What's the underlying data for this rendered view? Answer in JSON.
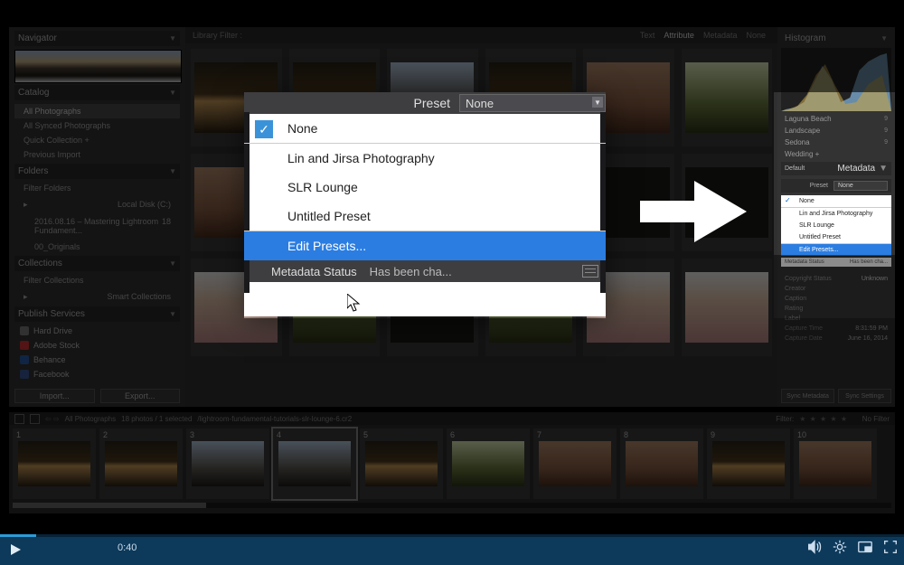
{
  "leftPanels": {
    "navigator": "Navigator",
    "catalog": {
      "title": "Catalog",
      "items": [
        "All Photographs",
        "All Synced Photographs",
        "Quick Collection +",
        "Previous Import"
      ]
    },
    "folders": {
      "title": "Folders",
      "filter": "Filter Folders",
      "drive": "Local Disk (C:)",
      "sub1": "2016.08.16 – Mastering Lightroom Fundament...",
      "sub2": "00_Originals",
      "count": "18"
    },
    "collections": {
      "title": "Collections",
      "filter": "Filter Collections",
      "smart": "Smart Collections"
    },
    "publish": {
      "title": "Publish Services",
      "items": [
        {
          "name": "Hard Drive",
          "color": "#7a7a7a"
        },
        {
          "name": "Adobe Stock",
          "color": "#c33"
        },
        {
          "name": "Behance",
          "color": "#2a5da8"
        },
        {
          "name": "Facebook",
          "color": "#3b5998"
        }
      ]
    },
    "importBtn": "Import...",
    "exportBtn": "Export..."
  },
  "filterBar": {
    "label": "Library Filter :",
    "tabs": [
      "Text",
      "Attribute",
      "Metadata",
      "None"
    ],
    "active": 1
  },
  "rightPanels": {
    "histogram": "Histogram",
    "keywords": [
      {
        "k": "Laguna Beach",
        "n": "9"
      },
      {
        "k": "Landscape",
        "n": "9"
      },
      {
        "k": "Sedona",
        "n": "9"
      },
      {
        "k": "Wedding +",
        "n": ""
      }
    ],
    "metaDefault": "Default",
    "metaTitle": "Metadata",
    "presetLabel": "Preset",
    "presetValue": "None",
    "dropdown": {
      "items": [
        "None",
        "Lin and Jirsa Photography",
        "SLR Lounge",
        "Untitled Preset",
        "Edit Presets..."
      ],
      "checked": 0,
      "highlighted": 4
    },
    "statusLabel": "Metadata Status",
    "statusValue": "Has been cha...",
    "info": [
      {
        "k": "Copyright Status",
        "v": "Unknown"
      },
      {
        "k": "Creator",
        "v": ""
      },
      {
        "k": "Caption",
        "v": ""
      },
      {
        "k": "Rating",
        "v": ""
      },
      {
        "k": "Label",
        "v": ""
      },
      {
        "k": "Capture Time",
        "v": "8:31:59 PM"
      },
      {
        "k": "Capture Date",
        "v": "June 16, 2014"
      }
    ],
    "btns": [
      "Sync Metadata",
      "Sync Settings"
    ]
  },
  "filmStrip": {
    "hdPath": "All Photographs",
    "hdCount": "18 photos / 1 selected",
    "hdFile": "/lightroom-fundamental-tutorials-slr-lounge-6.cr2",
    "filter": "Filter:",
    "nofilter": "No Filter",
    "items": [
      1,
      2,
      3,
      4,
      5,
      6,
      7,
      8,
      9,
      10
    ]
  },
  "modal": {
    "label": "Preset",
    "value": "None",
    "items": [
      "None",
      "Lin and Jirsa Photography",
      "SLR Lounge",
      "Untitled Preset",
      "Edit Presets..."
    ],
    "checked": 0,
    "highlighted": 4,
    "statusLabel": "Metadata Status",
    "statusValue": "Has been cha..."
  },
  "player": {
    "time": "0:40"
  }
}
